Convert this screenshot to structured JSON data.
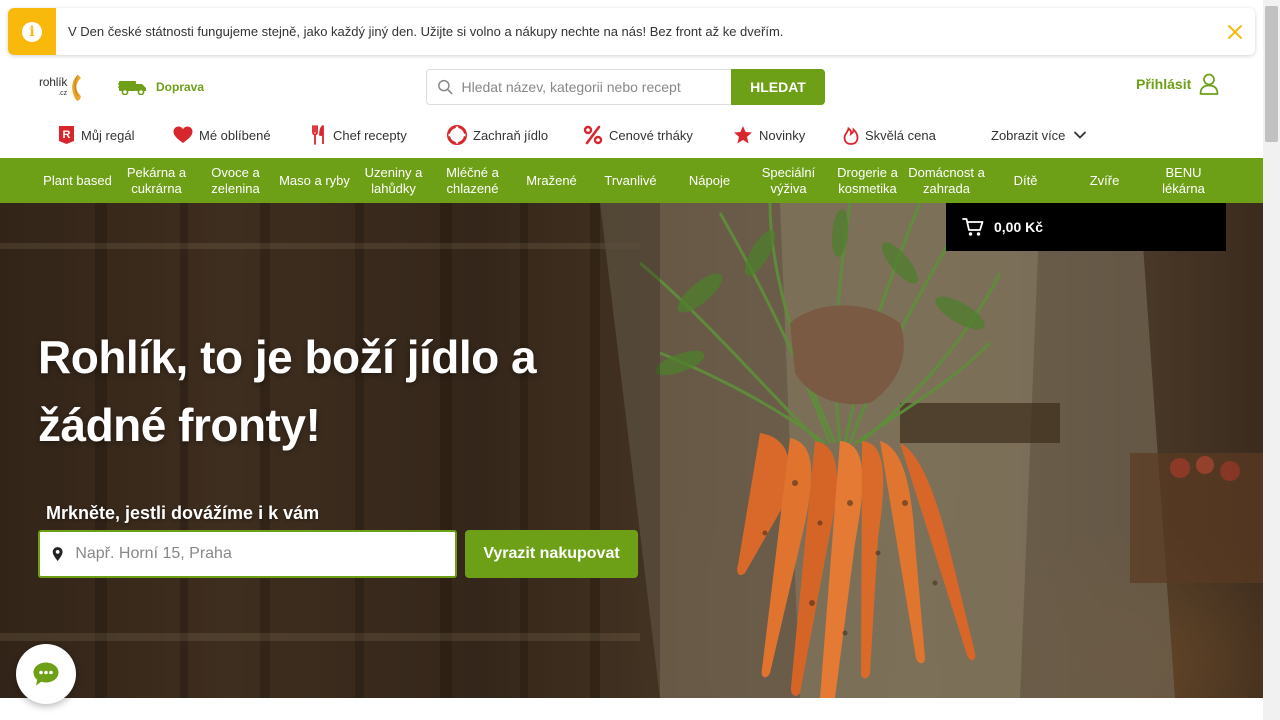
{
  "notice": {
    "text": "V Den české státnosti fungujeme stejně, jako každý jiný den. Užijte si volno a nákupy nechte na nás! Bez front až ke dveřím.",
    "icon": "info-icon",
    "close_icon": "close-icon"
  },
  "header": {
    "logo_text": "rohlík",
    "logo_domain": ".cz",
    "delivery_label": "Doprava",
    "search_placeholder": "Hledat název, kategorii nebo recept",
    "search_button": "HLEDAT",
    "login_label": "Přihlásit"
  },
  "quick_links": [
    {
      "label": "Můj regál",
      "icon": "shelf-icon"
    },
    {
      "label": "Mé oblíbené",
      "icon": "heart-icon"
    },
    {
      "label": "Chef recepty",
      "icon": "cutlery-icon"
    },
    {
      "label": "Zachraň jídlo",
      "icon": "lifebuoy-icon"
    },
    {
      "label": "Cenové trháky",
      "icon": "percent-icon"
    },
    {
      "label": "Novinky",
      "icon": "star-icon"
    },
    {
      "label": "Skvělá cena",
      "icon": "flame-icon"
    },
    {
      "label": "Zobrazit více",
      "icon": "chevron-down-icon"
    }
  ],
  "categories": [
    "Plant based",
    "Pekárna a cukrárna",
    "Ovoce a zelenina",
    "Maso a ryby",
    "Uzeniny a lahůdky",
    "Mléčné a chlazené",
    "Mražené",
    "Trvanlivé",
    "Nápoje",
    "Speciální výživa",
    "Drogerie a kosmetika",
    "Domácnost a zahrada",
    "Dítě",
    "Zvíře",
    "BENU lékárna"
  ],
  "cart": {
    "total": "0,00 Kč"
  },
  "hero": {
    "title_line1": "Rohlík, to je boží jídlo a",
    "title_line2": "žádné fronty!",
    "subtitle": "Mrkněte, jestli dovážíme i k vám",
    "address_placeholder": "Např. Horní 15, Praha",
    "cta_button": "Vyrazit nakupovat"
  },
  "colors": {
    "brand_green": "#6da016",
    "notice_yellow": "#f8b90c",
    "cart_black": "#000000",
    "quick_icon_red": "#d9262c"
  }
}
